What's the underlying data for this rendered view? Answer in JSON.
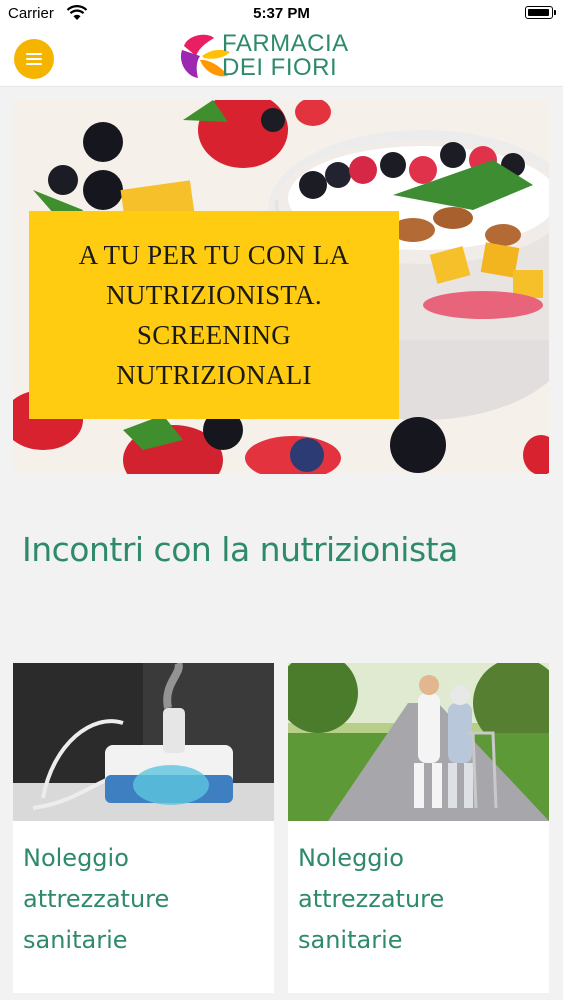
{
  "status_bar": {
    "carrier": "Carrier",
    "time": "5:37 PM",
    "icons": [
      "wifi-icon",
      "battery-icon"
    ]
  },
  "header": {
    "logo_line1": "FARMACIA",
    "logo_line2": "DEI FIORI",
    "menu_icon": "hamburger-icon",
    "accent_color": "#f4b400",
    "brand_color": "#2f8a6d"
  },
  "hero": {
    "banner_text": "A TU PER TU CON LA\nNUTRIZIONISTA.\nSCREENING\nNUTRIZIONALI",
    "banner_color": "#ffcc11"
  },
  "section": {
    "title": "Incontri con la nutrizionista"
  },
  "cards": [
    {
      "title": "Noleggio attrezzature sanitarie"
    },
    {
      "title": "Noleggio attrezzature sanitarie"
    }
  ]
}
